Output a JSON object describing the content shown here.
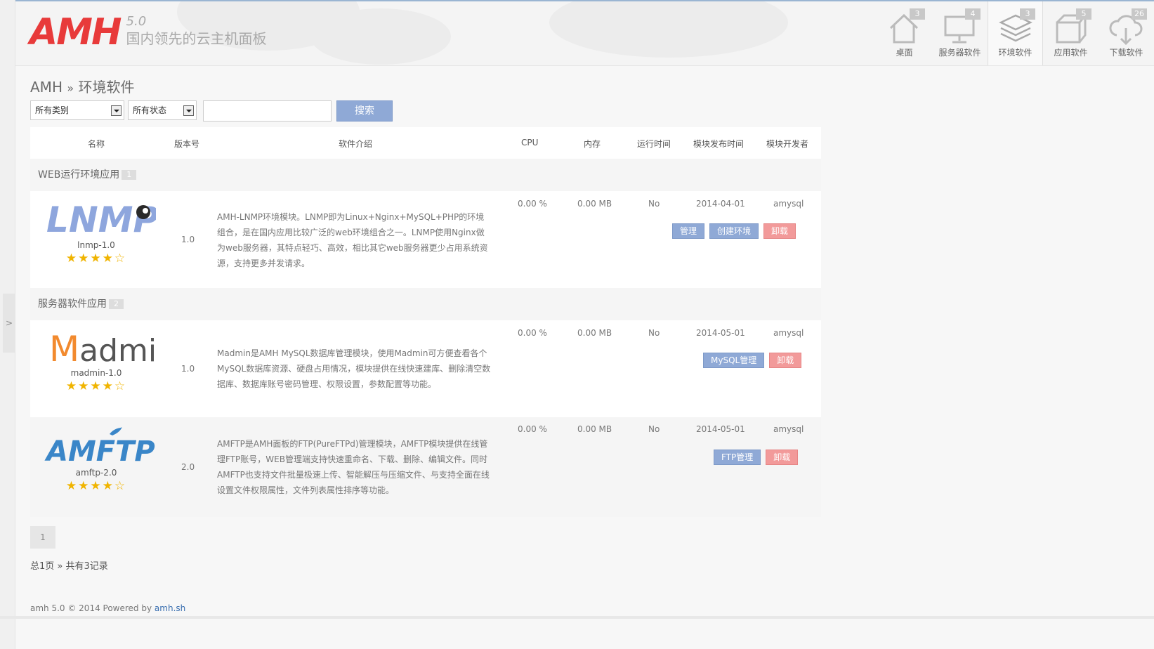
{
  "header": {
    "logo": "AMH",
    "version": "5.0",
    "slogan": "国内领先的云主机面板"
  },
  "nav": [
    {
      "label": "桌面",
      "count": "3",
      "icon": "house-icon"
    },
    {
      "label": "服务器软件",
      "count": "4",
      "icon": "monitor-icon"
    },
    {
      "label": "环境软件",
      "count": "3",
      "icon": "layers-icon",
      "active": true
    },
    {
      "label": "应用软件",
      "count": "5",
      "icon": "box-icon"
    },
    {
      "label": "下载软件",
      "count": "26",
      "icon": "cloud-download-icon"
    }
  ],
  "breadcrumb": {
    "root": "AMH",
    "separator": "»",
    "current": "环境软件"
  },
  "filters": {
    "category": "所有类别",
    "status": "所有状态",
    "search_placeholder": "",
    "search_button": "搜索"
  },
  "table": {
    "headers": {
      "name": "名称",
      "version": "版本号",
      "desc": "软件介绍",
      "cpu": "CPU",
      "memory": "内存",
      "running": "运行时间",
      "release": "模块发布时间",
      "developer": "模块开发者"
    },
    "groups": [
      {
        "title": "WEB运行环境应用",
        "count": "1"
      },
      {
        "title": "服务器软件应用",
        "count": "2"
      }
    ],
    "rows": [
      {
        "logo": "LNMP",
        "name": "lnmp-1.0",
        "stars": "★★★★☆",
        "version": "1.0",
        "desc": "AMH-LNMP环境模块。LNMP即为Linux+Nginx+MySQL+PHP的环境组合，是在国内应用比较广泛的web环境组合之一。LNMP使用Nginx做为web服务器，其特点轻巧、高效，相比其它web服务器更少占用系统资源，支持更多并发请求。",
        "cpu": "0.00 %",
        "memory": "0.00 MB",
        "running": "No",
        "release": "2014-04-01",
        "developer": "amysql",
        "buttons": [
          "管理",
          "创建环境",
          "卸载"
        ]
      },
      {
        "logo": "Madmin",
        "name": "madmin-1.0",
        "stars": "★★★★☆",
        "version": "1.0",
        "desc": "Madmin是AMH MySQL数据库管理模块，使用Madmin可方便查看各个MySQL数据库资源、硬盘占用情况，模块提供在线快速建库、删除清空数据库、数据库账号密码管理、权限设置，参数配置等功能。",
        "cpu": "0.00 %",
        "memory": "0.00 MB",
        "running": "No",
        "release": "2014-05-01",
        "developer": "amysql",
        "buttons": [
          "MySQL管理",
          "卸载"
        ]
      },
      {
        "logo": "AMFTP",
        "name": "amftp-2.0",
        "stars": "★★★★☆",
        "version": "2.0",
        "desc": "AMFTP是AMH面板的FTP(PureFTPd)管理模块，AMFTP模块提供在线管理FTP账号，WEB管理端支持快速重命名、下载、删除、编辑文件。同时AMFTP也支持文件批量极速上传、智能解压与压缩文件、与支持全面在线设置文件权限属性，文件列表属性排序等功能。",
        "cpu": "0.00 %",
        "memory": "0.00 MB",
        "running": "No",
        "release": "2014-05-01",
        "developer": "amysql",
        "buttons": [
          "FTP管理",
          "卸载"
        ]
      }
    ]
  },
  "pager": {
    "current": "1",
    "summary": "总1页 » 共有3记录"
  },
  "footer": {
    "text": "amh 5.0 © 2014 Powered by",
    "link": "amh.sh"
  },
  "sidebar_toggle": ">",
  "colors": {
    "brand": "#e83a3a",
    "button_blue": "#8fa9d6",
    "button_red": "#f29a9a",
    "star": "#f0b400"
  }
}
